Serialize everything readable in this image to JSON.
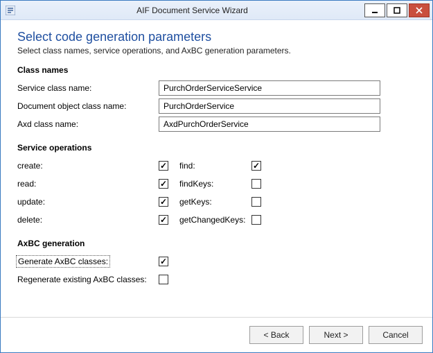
{
  "window": {
    "title": "AIF Document Service Wizard"
  },
  "header": {
    "title": "Select code generation parameters",
    "subtitle": "Select class names, service operations, and AxBC generation parameters."
  },
  "sections": {
    "classNames": {
      "heading": "Class names",
      "serviceClass": {
        "label": "Service class name:",
        "value": "PurchOrderServiceService"
      },
      "documentClass": {
        "label": "Document object class name:",
        "value": "PurchOrderService"
      },
      "axdClass": {
        "label": "Axd class name:",
        "value": "AxdPurchOrderService"
      }
    },
    "serviceOps": {
      "heading": "Service operations",
      "rows": [
        {
          "left": "create:",
          "leftChecked": true,
          "right": "find:",
          "rightChecked": true
        },
        {
          "left": "read:",
          "leftChecked": true,
          "right": "findKeys:",
          "rightChecked": false
        },
        {
          "left": "update:",
          "leftChecked": true,
          "right": "getKeys:",
          "rightChecked": false
        },
        {
          "left": "delete:",
          "leftChecked": true,
          "right": "getChangedKeys:",
          "rightChecked": false
        }
      ]
    },
    "axbc": {
      "heading": "AxBC generation",
      "generate": {
        "label": "Generate AxBC classes:",
        "checked": true
      },
      "regenerate": {
        "label": "Regenerate existing AxBC classes:",
        "checked": false
      }
    }
  },
  "footer": {
    "back": "< Back",
    "next": "Next >",
    "cancel": "Cancel"
  }
}
